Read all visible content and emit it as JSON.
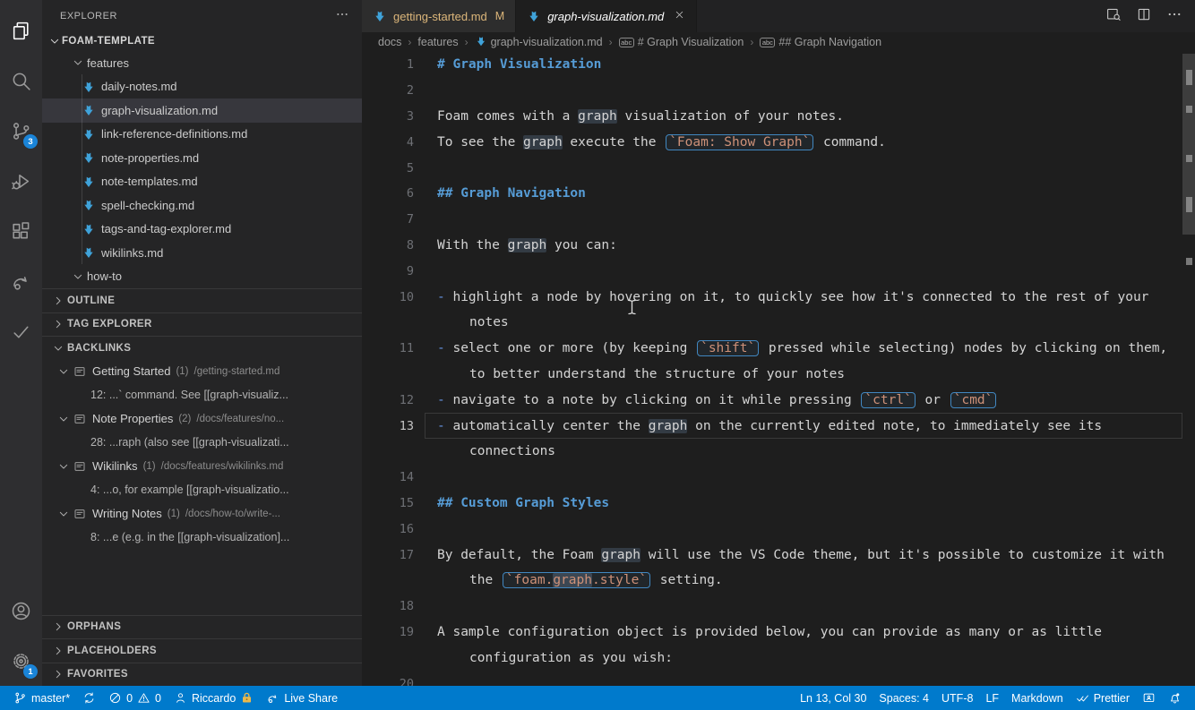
{
  "colors": {
    "status_bar": "#007acc",
    "badge_blue": "#1a84d8",
    "modified_file": "#dcb67a",
    "md_heading": "#569cd6",
    "inline_code": "#ce9178",
    "file_icon": "#3fa2d9",
    "selected_row": "#37373d",
    "word_highlight": "#333b44"
  },
  "activity_bar": {
    "items": [
      {
        "name": "explorer",
        "icon": "files",
        "active": true
      },
      {
        "name": "search",
        "icon": "search"
      },
      {
        "name": "source-control",
        "icon": "git",
        "badge": "3"
      },
      {
        "name": "run-debug",
        "icon": "debug"
      },
      {
        "name": "extensions",
        "icon": "ext"
      },
      {
        "name": "live-share",
        "icon": "share"
      },
      {
        "name": "tasks",
        "icon": "check"
      }
    ],
    "bottom": [
      {
        "name": "account",
        "icon": "account"
      },
      {
        "name": "settings",
        "icon": "gear",
        "badge": "1"
      }
    ]
  },
  "sidebar": {
    "title": "EXPLORER",
    "workspace": "FOAM-TEMPLATE",
    "tree": [
      {
        "label": "features",
        "type": "folder",
        "expanded": true
      },
      {
        "label": "daily-notes.md",
        "type": "file"
      },
      {
        "label": "graph-visualization.md",
        "type": "file",
        "selected": true
      },
      {
        "label": "link-reference-definitions.md",
        "type": "file"
      },
      {
        "label": "note-properties.md",
        "type": "file"
      },
      {
        "label": "note-templates.md",
        "type": "file"
      },
      {
        "label": "spell-checking.md",
        "type": "file"
      },
      {
        "label": "tags-and-tag-explorer.md",
        "type": "file"
      },
      {
        "label": "wikilinks.md",
        "type": "file"
      },
      {
        "label": "how-to",
        "type": "folder",
        "expanded": true
      }
    ],
    "sections_top": [
      {
        "label": "OUTLINE"
      },
      {
        "label": "TAG EXPLORER"
      }
    ],
    "backlinks_label": "BACKLINKS",
    "backlinks": [
      {
        "title": "Getting Started",
        "count": "(1)",
        "path": "/getting-started.md",
        "line": "12: ...` command. See [[graph-visualiz..."
      },
      {
        "title": "Note Properties",
        "count": "(2)",
        "path": "/docs/features/no...",
        "line": "28: ...raph (also see [[graph-visualizati..."
      },
      {
        "title": "Wikilinks",
        "count": "(1)",
        "path": "/docs/features/wikilinks.md",
        "line": "4: ...o, for example [[graph-visualizatio..."
      },
      {
        "title": "Writing Notes",
        "count": "(1)",
        "path": "/docs/how-to/write-...",
        "line": "8: ...e (e.g. in the [[graph-visualization]..."
      }
    ],
    "sections_bottom": [
      {
        "label": "ORPHANS"
      },
      {
        "label": "PLACEHOLDERS"
      },
      {
        "label": "FAVORITES"
      }
    ]
  },
  "tabs": [
    {
      "label": "getting-started.md",
      "badge": "M",
      "state": "modified",
      "active": false
    },
    {
      "label": "graph-visualization.md",
      "active": true,
      "preview": true,
      "closable": true
    }
  ],
  "breadcrumbs": {
    "separator": "›",
    "symbol_badge": "abc",
    "items": [
      {
        "label": "docs"
      },
      {
        "label": "features"
      },
      {
        "label": "graph-visualization.md",
        "icon": "mdfile"
      },
      {
        "label": "# Graph Visualization",
        "icon": "abc"
      },
      {
        "label": "## Graph Navigation",
        "icon": "abc"
      }
    ]
  },
  "editor": {
    "rows": [
      {
        "num": "1",
        "seg": [
          {
            "t": "# Graph Visualization",
            "s": "h"
          }
        ]
      },
      {
        "num": "2"
      },
      {
        "num": "3",
        "seg": [
          {
            "t": "Foam comes with a "
          },
          {
            "t": "graph",
            "s": "hl"
          },
          {
            "t": " visualization of your notes."
          }
        ]
      },
      {
        "num": "4",
        "seg": [
          {
            "t": "To see the "
          },
          {
            "t": "graph",
            "s": "hl"
          },
          {
            "t": " execute the "
          },
          {
            "box": [
              {
                "t": "`Foam: Show Graph`"
              }
            ]
          },
          {
            "t": " command."
          }
        ]
      },
      {
        "num": "5"
      },
      {
        "num": "6",
        "seg": [
          {
            "t": "## Graph Navigation",
            "s": "h"
          }
        ]
      },
      {
        "num": "7"
      },
      {
        "num": "8",
        "seg": [
          {
            "t": "With the "
          },
          {
            "t": "graph",
            "s": "hl"
          },
          {
            "t": " you can:"
          }
        ]
      },
      {
        "num": "9"
      },
      {
        "num": "10",
        "seg": [
          {
            "t": "- ",
            "s": "b"
          },
          {
            "t": "highlight a node by hovering on it, to quickly see how it's connected to the rest of your"
          }
        ]
      },
      {
        "wrap": true,
        "seg": [
          {
            "t": "notes"
          }
        ]
      },
      {
        "num": "11",
        "seg": [
          {
            "t": "- ",
            "s": "b"
          },
          {
            "t": "select one or more (by keeping "
          },
          {
            "box": [
              {
                "t": "`shift`"
              }
            ]
          },
          {
            "t": " pressed while selecting) nodes by clicking on them,"
          }
        ]
      },
      {
        "wrap": true,
        "seg": [
          {
            "t": "to better understand the structure of your notes"
          }
        ]
      },
      {
        "num": "12",
        "seg": [
          {
            "t": "- ",
            "s": "b"
          },
          {
            "t": "navigate to a note by clicking on it while pressing "
          },
          {
            "box": [
              {
                "t": "`ctrl`"
              }
            ]
          },
          {
            "t": " or "
          },
          {
            "box": [
              {
                "t": "`cmd`"
              }
            ]
          }
        ]
      },
      {
        "num": "13",
        "current": true,
        "seg": [
          {
            "t": "- ",
            "s": "b"
          },
          {
            "t": "automatically center the "
          },
          {
            "t": "graph",
            "s": "hl"
          },
          {
            "t": " on the currently edited note, to immediately see its"
          }
        ]
      },
      {
        "wrap": true,
        "seg": [
          {
            "t": "connections"
          }
        ]
      },
      {
        "num": "14"
      },
      {
        "num": "15",
        "seg": [
          {
            "t": "## Custom Graph Styles",
            "s": "h"
          }
        ]
      },
      {
        "num": "16"
      },
      {
        "num": "17",
        "seg": [
          {
            "t": "By default, the Foam "
          },
          {
            "t": "graph",
            "s": "hl"
          },
          {
            "t": " will use the VS Code theme, but it's possible to customize it with"
          }
        ]
      },
      {
        "wrap": true,
        "seg": [
          {
            "t": "the "
          },
          {
            "box": [
              {
                "t": "`foam."
              },
              {
                "t": "graph",
                "s": "hl"
              },
              {
                "t": ".style`"
              }
            ]
          },
          {
            "t": " setting."
          }
        ]
      },
      {
        "num": "18"
      },
      {
        "num": "19",
        "seg": [
          {
            "t": "A sample configuration object is provided below, you can provide as many or as little"
          }
        ]
      },
      {
        "wrap": true,
        "seg": [
          {
            "t": "configuration as you wish:"
          }
        ]
      },
      {
        "num": "20"
      }
    ]
  },
  "editor_actions": [
    {
      "name": "open-preview",
      "icon": "preview"
    },
    {
      "name": "split-editor",
      "icon": "split"
    },
    {
      "name": "more-actions",
      "icon": "ellipsis"
    }
  ],
  "status_bar": {
    "left": [
      {
        "name": "git-branch",
        "icon": "branch",
        "label": "master*"
      },
      {
        "name": "sync",
        "icon": "sync"
      },
      {
        "name": "problems",
        "icon": "error",
        "label": "0",
        "icon2": "warning",
        "label2": "0"
      },
      {
        "name": "live-share-user",
        "icon": "person",
        "label": "Riccardo",
        "icon2": "lock"
      },
      {
        "name": "live-share",
        "icon": "share",
        "label": "Live Share"
      }
    ],
    "right": [
      {
        "name": "cursor-position",
        "label": "Ln 13, Col 30"
      },
      {
        "name": "indentation",
        "label": "Spaces: 4"
      },
      {
        "name": "encoding",
        "label": "UTF-8"
      },
      {
        "name": "eol",
        "label": "LF"
      },
      {
        "name": "language-mode",
        "label": "Markdown"
      },
      {
        "name": "prettier",
        "icon": "dblcheck",
        "label": "Prettier"
      },
      {
        "name": "feedback",
        "icon": "feedback"
      },
      {
        "name": "notifications",
        "icon": "bell"
      }
    ]
  }
}
